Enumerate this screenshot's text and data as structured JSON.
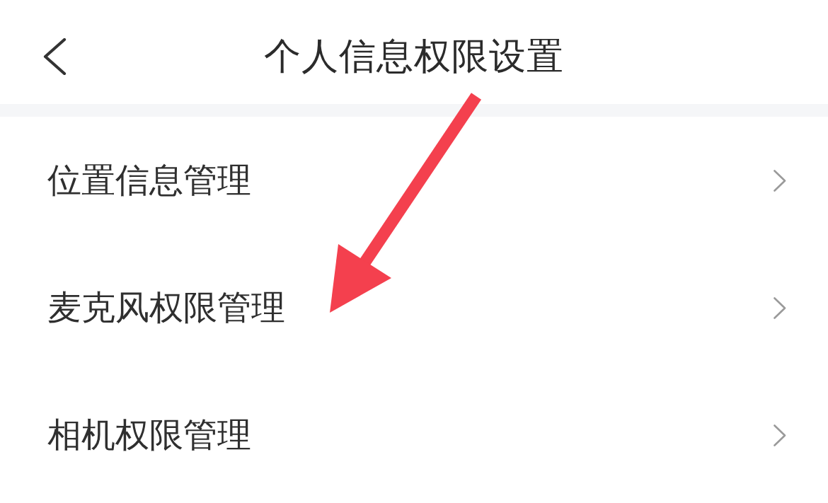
{
  "header": {
    "title": "个人信息权限设置"
  },
  "menu_items": [
    {
      "label": "位置信息管理"
    },
    {
      "label": "麦克风权限管理"
    },
    {
      "label": "相机权限管理"
    }
  ],
  "annotations": [
    {
      "kind": "arrow"
    }
  ]
}
